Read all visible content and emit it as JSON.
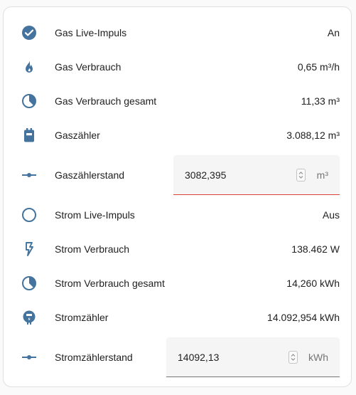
{
  "colors": {
    "icon": "#44739e",
    "active_underline": "#db4437",
    "default_underline": "#757575"
  },
  "rows": [
    {
      "icon": "check-circle-icon",
      "label": "Gas Live-Impuls",
      "value": "An"
    },
    {
      "icon": "fire-icon",
      "label": "Gas Verbrauch",
      "value": "0,65 m³/h"
    },
    {
      "icon": "pie-chart-icon",
      "label": "Gas Verbrauch gesamt",
      "value": "11,33 m³"
    },
    {
      "icon": "gas-meter-icon",
      "label": "Gaszähler",
      "value": "3.088,12 m³"
    },
    {
      "icon": "ray-vertex-icon",
      "label": "Gaszählerstand",
      "input_value": "3082,395",
      "unit": "m³"
    },
    {
      "icon": "circle-outline-icon",
      "label": "Strom Live-Impuls",
      "value": "Aus"
    },
    {
      "icon": "flash-outline-icon",
      "label": "Strom Verbrauch",
      "value": "138.462 W"
    },
    {
      "icon": "pie-chart-icon",
      "label": "Strom Verbrauch gesamt",
      "value": "14,260 kWh"
    },
    {
      "icon": "electric-meter-icon",
      "label": "Stromzähler",
      "value": "14.092,954 kWh"
    },
    {
      "icon": "ray-vertex-icon",
      "label": "Stromzählerstand",
      "input_value": "14092,13",
      "unit": "kWh"
    }
  ]
}
